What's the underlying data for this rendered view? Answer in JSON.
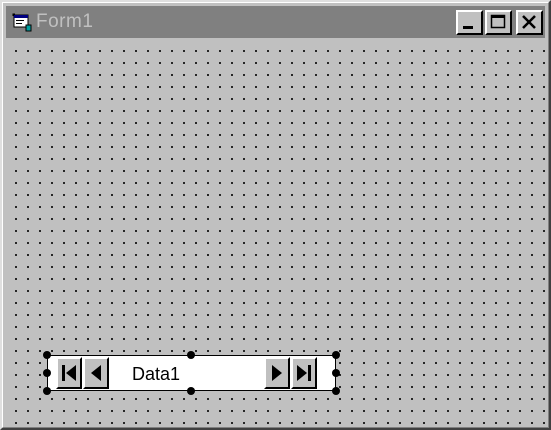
{
  "window": {
    "title": "Form1",
    "icon": "form-icon",
    "controls": {
      "minimize": "minimize-icon",
      "maximize": "maximize-icon",
      "close": "close-icon"
    }
  },
  "data_control": {
    "caption": "Data1",
    "buttons": {
      "first": "move-first-icon",
      "previous": "move-previous-icon",
      "next": "move-next-icon",
      "last": "move-last-icon"
    }
  },
  "colors": {
    "face": "#c0c0c0",
    "titlebar": "#808080",
    "grid_dot": "#000000"
  }
}
